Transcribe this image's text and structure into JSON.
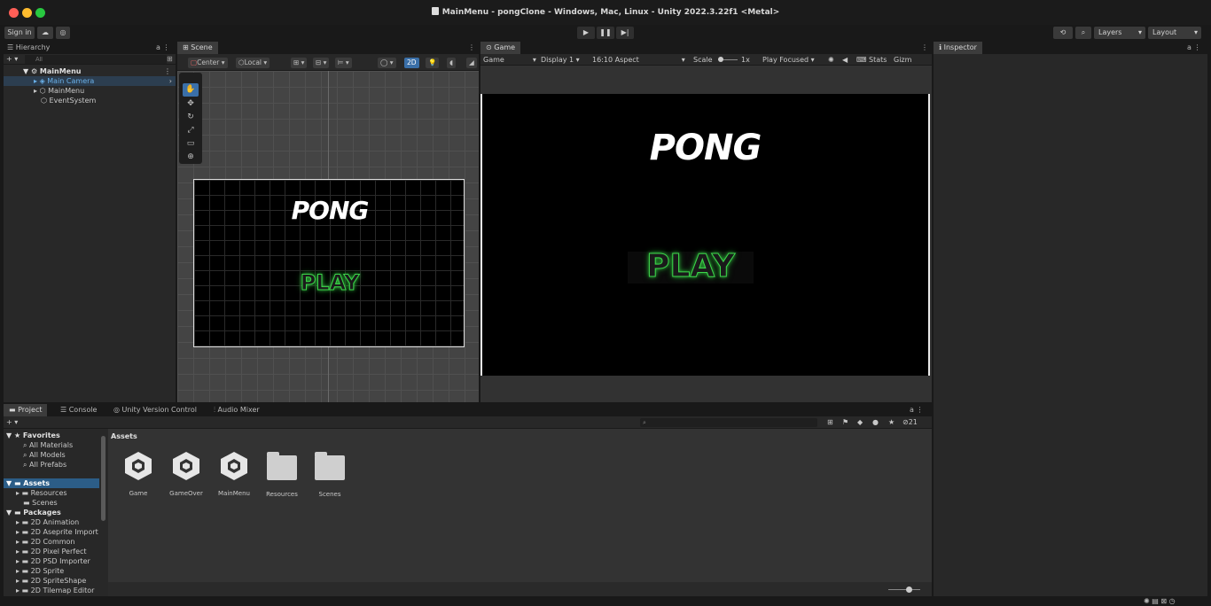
{
  "window": {
    "title": "MainMenu - pongClone - Windows, Mac, Linux - Unity 2022.3.22f1 <Metal>"
  },
  "toolbar": {
    "sign_in": "Sign in",
    "play_icon": "play-icon",
    "pause_icon": "pause-icon",
    "step_icon": "step-icon",
    "layers": "Layers",
    "layout": "Layout"
  },
  "hierarchy": {
    "tab": "Hierarchy",
    "search_placeholder": "All",
    "scene_name": "MainMenu",
    "items": [
      {
        "label": "Main Camera"
      },
      {
        "label": "MainMenu"
      },
      {
        "label": "EventSystem"
      }
    ]
  },
  "scene": {
    "tab": "Scene",
    "pivot": "Center",
    "space": "Local",
    "mode_2d": "2D",
    "title_text": "PONG",
    "button_text": "PLAY"
  },
  "game": {
    "tab": "Game",
    "mode": "Game",
    "display": "Display 1",
    "aspect": "16:10 Aspect",
    "scale_label": "Scale",
    "scale_value": "1x",
    "play_focused": "Play Focused",
    "stats": "Stats",
    "gizmos": "Gizm",
    "title_text": "PONG",
    "button_text": "PLAY"
  },
  "inspector": {
    "tab": "Inspector"
  },
  "bottom_tabs": {
    "project": "Project",
    "console": "Console",
    "version_control": "Unity Version Control",
    "audio_mixer": "Audio Mixer",
    "hidden_count": "21"
  },
  "project_tree": {
    "favorites": "Favorites",
    "favorite_items": [
      "All Materials",
      "All Models",
      "All Prefabs"
    ],
    "assets": "Assets",
    "asset_items": [
      "Resources",
      "Scenes"
    ],
    "packages": "Packages",
    "package_items": [
      "2D Animation",
      "2D Aseprite Import",
      "2D Common",
      "2D Pixel Perfect",
      "2D PSD Importer",
      "2D Sprite",
      "2D SpriteShape",
      "2D Tilemap Editor"
    ]
  },
  "asset_browser": {
    "breadcrumb": "Assets",
    "items": [
      {
        "name": "Game",
        "kind": "scene"
      },
      {
        "name": "GameOver",
        "kind": "scene"
      },
      {
        "name": "MainMenu",
        "kind": "scene"
      },
      {
        "name": "Resources",
        "kind": "folder"
      },
      {
        "name": "Scenes",
        "kind": "folder"
      }
    ]
  },
  "colors": {
    "accent": "#2c5d87",
    "play_glow": "#3cd64a",
    "panel": "#282828"
  }
}
